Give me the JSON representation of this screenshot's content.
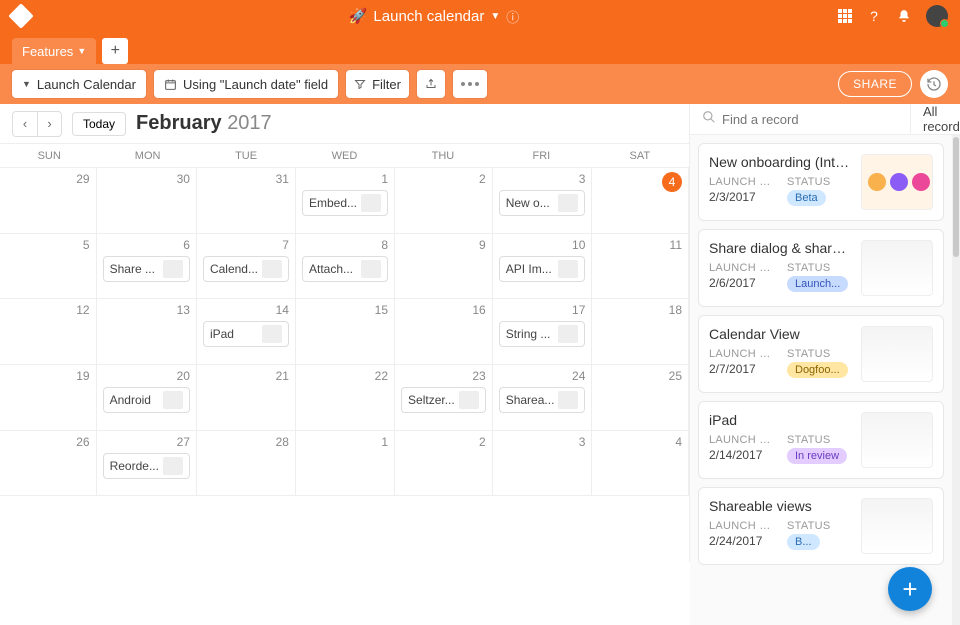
{
  "header": {
    "emoji": "🚀",
    "title": "Launch calendar"
  },
  "tabs": {
    "active": "Features"
  },
  "toolbar": {
    "view_label": "Launch Calendar",
    "field_label": "Using \"Launch date\" field",
    "filter_label": "Filter",
    "share_label": "SHARE"
  },
  "calendar": {
    "today_label": "Today",
    "month": "February",
    "year": "2017",
    "weekdays": [
      "SUN",
      "MON",
      "TUE",
      "WED",
      "THU",
      "FRI",
      "SAT"
    ],
    "cells": [
      {
        "num": "29"
      },
      {
        "num": "30"
      },
      {
        "num": "31"
      },
      {
        "num": "1",
        "event": "Embed..."
      },
      {
        "num": "2"
      },
      {
        "num": "3",
        "event": "New o..."
      },
      {
        "num": "4",
        "today": true
      },
      {
        "num": "5"
      },
      {
        "num": "6",
        "event": "Share ..."
      },
      {
        "num": "7",
        "event": "Calend..."
      },
      {
        "num": "8",
        "event": "Attach..."
      },
      {
        "num": "9"
      },
      {
        "num": "10",
        "event": "API Im..."
      },
      {
        "num": "11"
      },
      {
        "num": "12"
      },
      {
        "num": "13"
      },
      {
        "num": "14",
        "event": "iPad"
      },
      {
        "num": "15"
      },
      {
        "num": "16"
      },
      {
        "num": "17",
        "event": "String ..."
      },
      {
        "num": "18"
      },
      {
        "num": "19"
      },
      {
        "num": "20",
        "event": "Android"
      },
      {
        "num": "21"
      },
      {
        "num": "22"
      },
      {
        "num": "23",
        "event": "Seltzer..."
      },
      {
        "num": "24",
        "event": "Sharea..."
      },
      {
        "num": "25"
      },
      {
        "num": "26"
      },
      {
        "num": "27",
        "event": "Reorde..."
      },
      {
        "num": "28"
      },
      {
        "num": "1"
      },
      {
        "num": "2"
      },
      {
        "num": "3"
      },
      {
        "num": "4"
      }
    ]
  },
  "side": {
    "search_placeholder": "Find a record",
    "filter_label": "All records",
    "field_labels": {
      "date": "LAUNCH DA...",
      "status": "STATUS"
    },
    "records": [
      {
        "title": "New onboarding (Inter...",
        "date": "2/3/2017",
        "status": "Beta",
        "status_bg": "#cfe8ff",
        "status_fg": "#2a6db0"
      },
      {
        "title": "Share dialog & shared ...",
        "date": "2/6/2017",
        "status": "Launch...",
        "status_bg": "#c7dbff",
        "status_fg": "#3353b8"
      },
      {
        "title": "Calendar View",
        "date": "2/7/2017",
        "status": "Dogfoo...",
        "status_bg": "#ffe7a3",
        "status_fg": "#8a6400"
      },
      {
        "title": "iPad",
        "date": "2/14/2017",
        "status": "In review",
        "status_bg": "#e3ccff",
        "status_fg": "#6b3bbf"
      },
      {
        "title": "Shareable views",
        "date": "2/24/2017",
        "status": "B...",
        "status_bg": "#cfe8ff",
        "status_fg": "#2a6db0"
      }
    ]
  }
}
